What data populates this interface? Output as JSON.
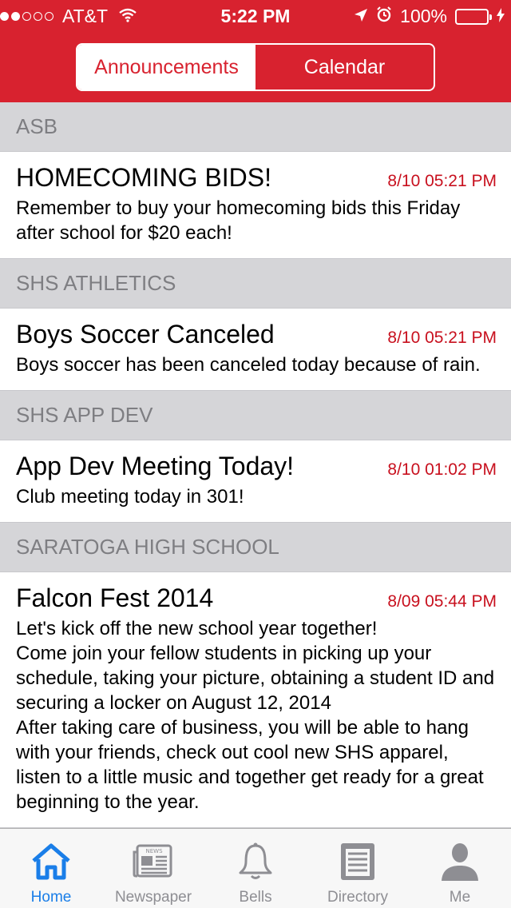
{
  "status_bar": {
    "carrier": "AT&T",
    "time": "5:22 PM",
    "battery": "100%"
  },
  "segments": [
    {
      "label": "Announcements",
      "active": true
    },
    {
      "label": "Calendar",
      "active": false
    }
  ],
  "sections": [
    {
      "header": "ASB",
      "items": [
        {
          "title": "HOMECOMING BIDS!",
          "time": "8/10 05:21 PM",
          "body": "Remember to buy your homecoming bids this Friday after school for $20 each!"
        }
      ]
    },
    {
      "header": "SHS ATHLETICS",
      "items": [
        {
          "title": "Boys Soccer Canceled",
          "time": "8/10 05:21 PM",
          "body": "Boys soccer has been canceled today because of rain."
        }
      ]
    },
    {
      "header": "SHS APP DEV",
      "items": [
        {
          "title": "App Dev Meeting Today!",
          "time": "8/10 01:02 PM",
          "body": "Club meeting today in 301!"
        }
      ]
    },
    {
      "header": "SARATOGA HIGH SCHOOL",
      "items": [
        {
          "title": "Falcon Fest 2014",
          "time": "8/09 05:44 PM",
          "body": "Let's kick off the new school year together!\nCome join your fellow students in picking up your schedule, taking your picture, obtaining a student ID and securing a locker on August 12, 2014\nAfter taking care of business, you will be able to hang with your friends, check out cool new SHS apparel, listen to a little music and together get ready for a great beginning to the year."
        }
      ]
    }
  ],
  "tabs": [
    {
      "label": "Home",
      "icon": "home-icon",
      "active": true
    },
    {
      "label": "Newspaper",
      "icon": "newspaper-icon",
      "active": false
    },
    {
      "label": "Bells",
      "icon": "bell-icon",
      "active": false
    },
    {
      "label": "Directory",
      "icon": "directory-icon",
      "active": false
    },
    {
      "label": "Me",
      "icon": "person-icon",
      "active": false
    }
  ],
  "colors": {
    "brand_red": "#d8222f",
    "time_red": "#c8101e",
    "tab_active": "#1a7ee8",
    "tab_inactive": "#8e8e93"
  },
  "newspaper_icon_text": "NEWS"
}
